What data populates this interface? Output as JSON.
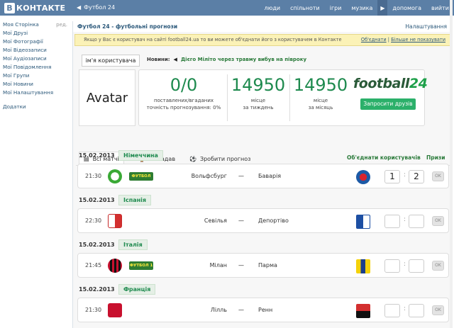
{
  "topbar": {
    "brand": "В КОНТАКТЕ",
    "logo_letter": "В",
    "logo_text": "КОНТАКТЕ",
    "app_back": "Футбол 24",
    "nav": [
      "люди",
      "спільноти",
      "ігри",
      "музика",
      "допомога",
      "вийти"
    ]
  },
  "sidebar": {
    "edit_label": "ред.",
    "items": [
      "Моя Сторінка",
      "Мої Друзі",
      "Мої Фотографії",
      "Мої Відеозаписи",
      "Мої Аудіозаписи",
      "Мої Повідомлення",
      "Мої Групи",
      "Мої Новини",
      "Мої Налаштування"
    ],
    "extra": "Додатки"
  },
  "app": {
    "title": "Футбол 24 - футбольні прогнози",
    "settings": "Налаштування",
    "notice": "Якщо у Вас є користувач на сайті football24.ua то ви можете об'єднати його з користувачем в Контакте",
    "notice_merge": "Об'єднати",
    "notice_hide": "Більше не показувати"
  },
  "profile": {
    "username": "ім'я користувача",
    "news_label": "Новини:",
    "news_text": "Дієго Міліто через травму вибув на півроку",
    "avatar": "Avatar",
    "stats": [
      {
        "value": "0/0",
        "caption1": "поставлених/вгаданих",
        "caption2": "точність прогнозування: 0%"
      },
      {
        "value": "14950",
        "caption1": "місце",
        "caption2": "за тиждень"
      },
      {
        "value": "14950",
        "caption1": "місце",
        "caption2": "за місяць"
      }
    ],
    "brand_part1": "football",
    "brand_part2": "24",
    "invite": "Запросити друзів"
  },
  "tabs": {
    "all": "Всі матчі",
    "guessed": "Я вгадав",
    "predict": "Зробити прогноз",
    "merge_users": "Об'єднати користувачів",
    "prizes": "Призи"
  },
  "matches": [
    {
      "date": "15.02.2013",
      "country": "Німеччина",
      "time": "21:30",
      "channel": "ФУТБОЛ",
      "home": "Вольфсбург",
      "away": "Баварія",
      "score_home": "1",
      "score_away": "2",
      "ok": "OK"
    },
    {
      "date": "15.02.2013",
      "country": "Іспанія",
      "time": "22:30",
      "channel": "",
      "home": "Севілья",
      "away": "Депортіво",
      "score_home": "",
      "score_away": "",
      "ok": "OK"
    },
    {
      "date": "15.02.2013",
      "country": "Італія",
      "time": "21:45",
      "channel": "ФУТБОЛ 1",
      "home": "Мілан",
      "away": "Парма",
      "score_home": "",
      "score_away": "",
      "ok": "OK"
    },
    {
      "date": "15.02.2013",
      "country": "Франція",
      "time": "21:30",
      "channel": "",
      "home": "Лілль",
      "away": "Ренн",
      "score_home": "",
      "score_away": "",
      "ok": "OK"
    }
  ],
  "dash": "—",
  "colon": ":",
  "colors": {
    "vk_blue": "#5b7fa6",
    "green": "#1e8a4e",
    "notice_bg": "#fbf2b7"
  }
}
